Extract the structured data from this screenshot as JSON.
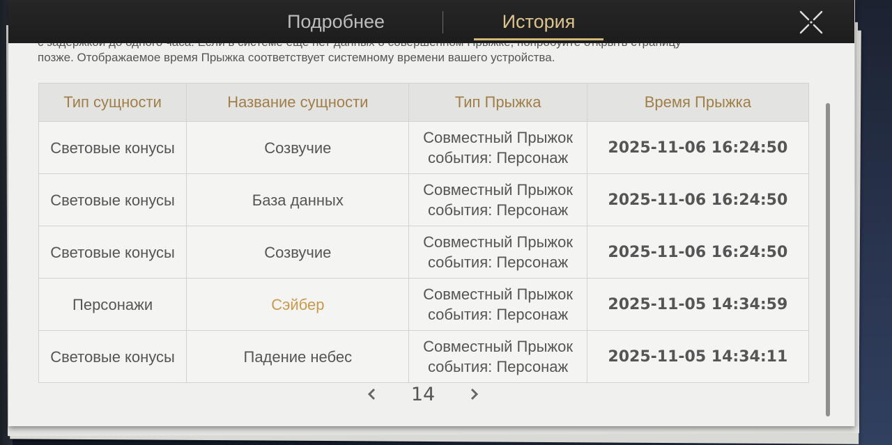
{
  "tabs": {
    "details_label": "Подробнее",
    "history_label": "История"
  },
  "notice": {
    "line1": "с задержкой до одного часа. Если в системе еще нет данных о совершенном Прыжке, попробуйте открыть страницу",
    "line2": "позже. Отображаемое время Прыжка соответствует системному времени вашего устройства."
  },
  "table": {
    "headers": [
      "Тип сущности",
      "Название сущности",
      "Тип Прыжка",
      "Время Прыжка"
    ],
    "rows": [
      {
        "entity_type": "Световые конусы",
        "entity_name": "Созвучие",
        "jump_type": "Совместный Прыжок события: Персонаж",
        "jump_time": "2025-11-06 16:24:50"
      },
      {
        "entity_type": "Световые конусы",
        "entity_name": "База данных",
        "jump_type": "Совместный Прыжок события: Персонаж",
        "jump_time": "2025-11-06 16:24:50"
      },
      {
        "entity_type": "Световые конусы",
        "entity_name": "Созвучие",
        "jump_type": "Совместный Прыжок события: Персонаж",
        "jump_time": "2025-11-06 16:24:50"
      },
      {
        "entity_type": "Персонажи",
        "entity_name": "Сэйбер",
        "jump_type": "Совместный Прыжок события: Персонаж",
        "jump_time": "2025-11-05 14:34:59"
      },
      {
        "entity_type": "Световые конусы",
        "entity_name": "Падение небес",
        "jump_type": "Совместный Прыжок события: Персонаж",
        "jump_time": "2025-11-05 14:34:11"
      }
    ]
  },
  "pager": {
    "page": "14"
  },
  "icons": {
    "close": "close-icon",
    "prev": "chevron-left-icon",
    "next": "chevron-right-icon"
  },
  "colors": {
    "accent_gold": "#d4b878",
    "header_text": "#a07e48",
    "highlight_name": "#c89a4e"
  }
}
